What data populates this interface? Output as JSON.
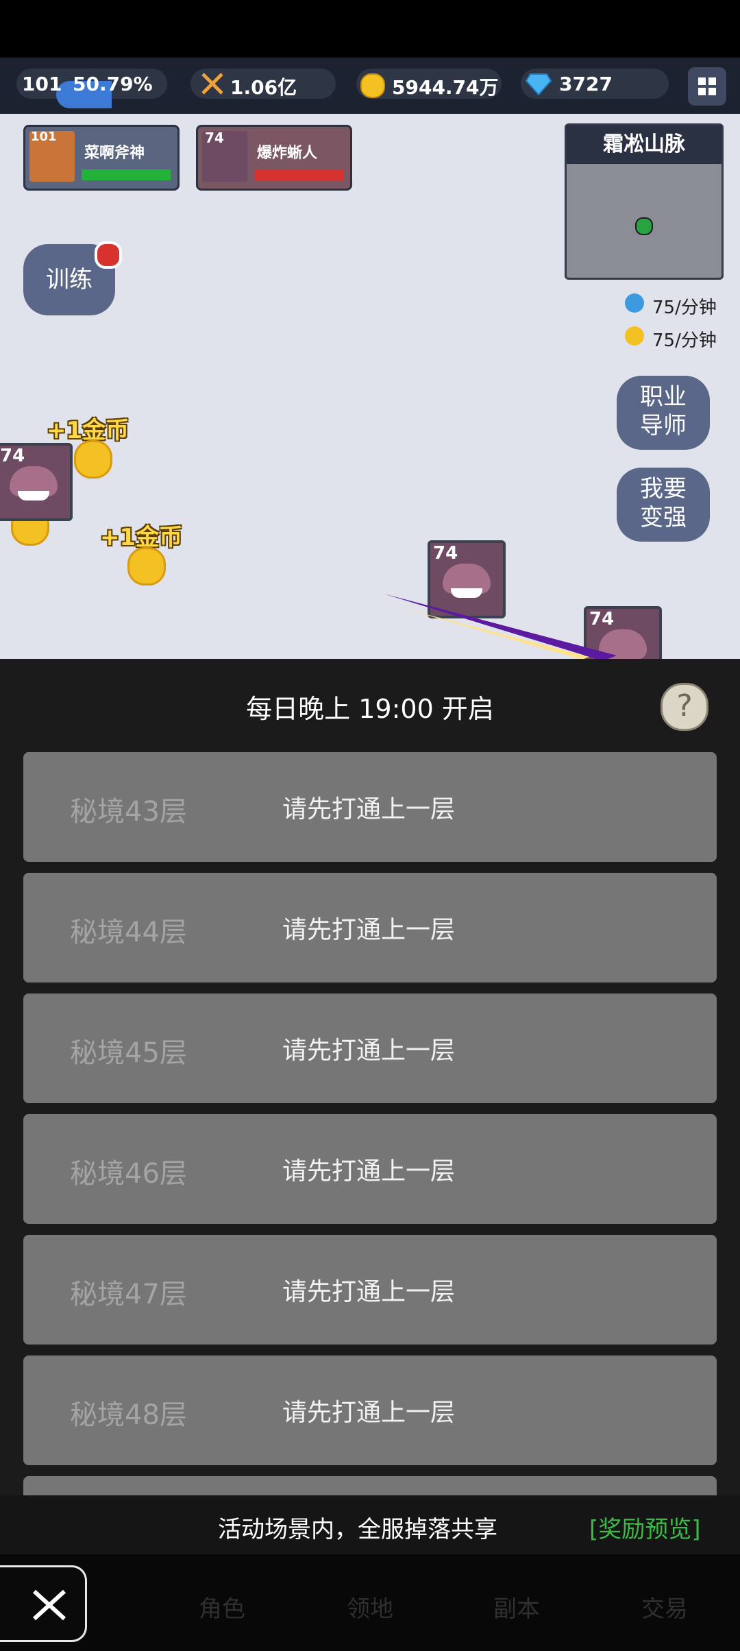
{
  "status_bar": {
    "level": "101",
    "exp_percent_label": "50.79%",
    "exp_fraction": 0.5079,
    "power": "1.06亿",
    "gold": "5944.74万",
    "diamonds": "3727"
  },
  "party": [
    {
      "level": "101",
      "name": "菜啊斧神",
      "hp_color": "#24b23a"
    },
    {
      "level": "74",
      "name": "爆炸蜥人",
      "hp_color": "#d8322e"
    }
  ],
  "minimap": {
    "title": "霜凇山脉"
  },
  "rates": {
    "exp": "75/分钟",
    "gold": "75/分钟"
  },
  "buttons": {
    "train": "训练",
    "mentor_line1": "职业",
    "mentor_line2": "导师",
    "stronger_line1": "我要",
    "stronger_line2": "变强"
  },
  "coin_drops": [
    "+1金币",
    "+1金币"
  ],
  "monsters": [
    "74",
    "74",
    "74"
  ],
  "dungeon": {
    "header": "每日晚上 19:00 开启",
    "help": "?",
    "floors": [
      {
        "name": "秘境43层",
        "status": "请先打通上一层"
      },
      {
        "name": "秘境44层",
        "status": "请先打通上一层"
      },
      {
        "name": "秘境45层",
        "status": "请先打通上一层"
      },
      {
        "name": "秘境46层",
        "status": "请先打通上一层"
      },
      {
        "name": "秘境47层",
        "status": "请先打通上一层"
      },
      {
        "name": "秘境48层",
        "status": "请先打通上一层"
      }
    ],
    "footer_text": "活动场景内，全服掉落共享",
    "reward_preview": "[奖励预览]"
  },
  "bottom_nav": [
    "角色",
    "领地",
    "副本",
    "交易"
  ],
  "colors": {
    "accent_green": "#3fb84a",
    "exp_blue": "#3d7ad6"
  }
}
